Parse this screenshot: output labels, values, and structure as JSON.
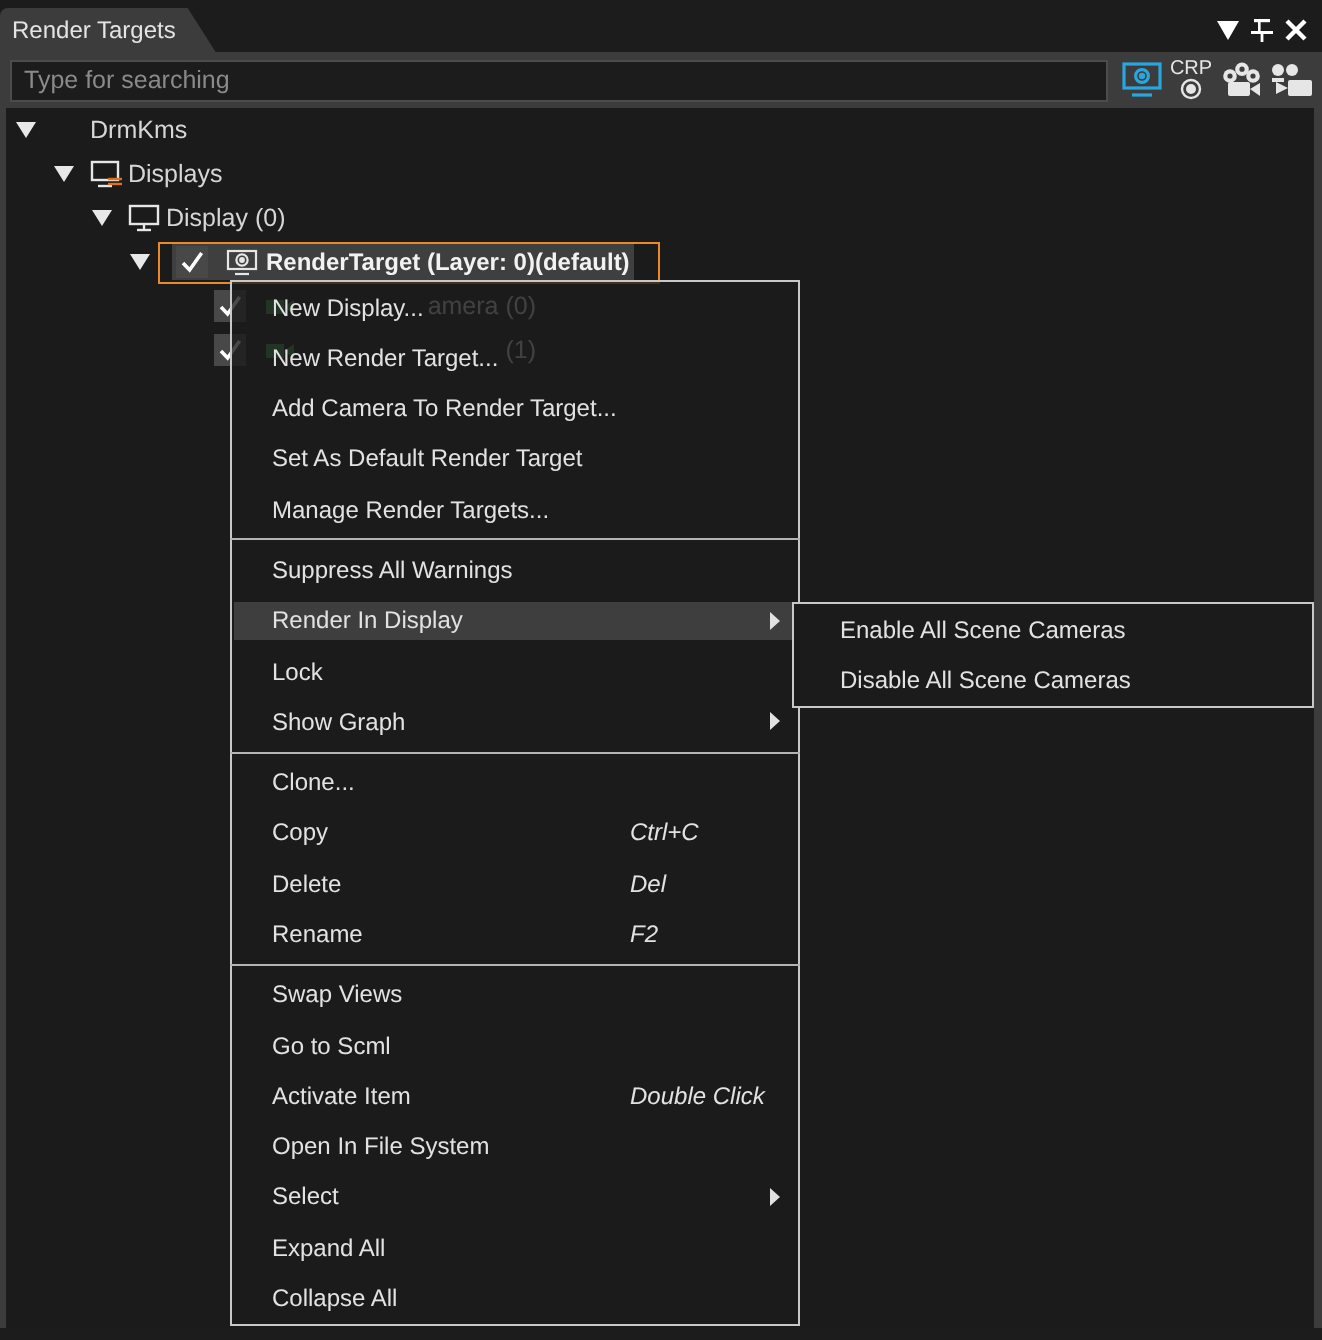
{
  "panel": {
    "title": "Render Targets"
  },
  "search": {
    "placeholder": "Type for searching"
  },
  "toolbar": [
    {
      "kind": "monitor",
      "selected": true
    },
    {
      "kind": "crp",
      "label": "CRP",
      "selected": false
    },
    {
      "kind": "camera-group",
      "selected": false
    },
    {
      "kind": "camera",
      "selected": false
    }
  ],
  "tree": [
    {
      "label": "DrmKms",
      "expanded": true,
      "selected": false,
      "children": [
        {
          "label": "Displays",
          "kind": "displays",
          "expanded": true,
          "selected": false,
          "children": [
            {
              "label": "Display (0)",
              "kind": "display",
              "expanded": true,
              "selected": false,
              "children": [
                {
                  "label": "RenderTarget (Layer: 0)(default)",
                  "kind": "render-target",
                  "checked": true,
                  "expanded": true,
                  "selected": true,
                  "children": [
                    {
                      "label": "amera (0)",
                      "kind": "camera",
                      "checked": true,
                      "selected": false
                    },
                    {
                      "label": "(1)",
                      "kind": "camera",
                      "checked": true,
                      "selected": false
                    }
                  ]
                }
              ]
            }
          ]
        }
      ]
    }
  ],
  "context_menu": {
    "groups": [
      {
        "items": [
          {
            "label": "New Display...",
            "kind": "command",
            "selected": false
          },
          {
            "label": "New Render Target...",
            "kind": "command",
            "selected": false
          },
          {
            "label": "Add Camera To Render Target...",
            "kind": "command",
            "selected": false
          },
          {
            "label": "Set As Default Render Target",
            "kind": "command",
            "selected": false
          },
          {
            "label": "Manage Render Targets...",
            "kind": "command",
            "selected": false
          }
        ]
      },
      {
        "items": [
          {
            "label": "Suppress All Warnings",
            "kind": "command",
            "selected": false
          },
          {
            "label": "Render In Display",
            "kind": "submenu",
            "selected": true
          },
          {
            "label": "Lock",
            "kind": "command",
            "selected": false
          },
          {
            "label": "Show Graph",
            "kind": "submenu",
            "selected": false
          }
        ]
      },
      {
        "items": [
          {
            "label": "Clone...",
            "kind": "command",
            "selected": false
          },
          {
            "label": "Copy",
            "shortcut": "Ctrl+C",
            "kind": "command",
            "selected": false
          },
          {
            "label": "Delete",
            "shortcut": "Del",
            "kind": "command",
            "selected": false
          },
          {
            "label": "Rename",
            "shortcut": "F2",
            "kind": "command",
            "selected": false
          }
        ]
      },
      {
        "items": [
          {
            "label": "Swap Views",
            "kind": "command",
            "selected": false
          },
          {
            "label": "Go to Scml",
            "kind": "command",
            "selected": false
          },
          {
            "label": "Activate Item",
            "shortcut": "Double Click",
            "kind": "command",
            "selected": false
          },
          {
            "label": "Open In File System",
            "kind": "command",
            "selected": false
          },
          {
            "label": "Select",
            "kind": "submenu",
            "selected": false
          },
          {
            "label": "Expand All",
            "kind": "command",
            "selected": false
          },
          {
            "label": "Collapse All",
            "kind": "command",
            "selected": false
          }
        ]
      }
    ]
  },
  "submenu": {
    "items": [
      {
        "label": "Enable All Scene Cameras",
        "selected": false
      },
      {
        "label": "Disable All Scene Cameras",
        "selected": false
      }
    ]
  }
}
